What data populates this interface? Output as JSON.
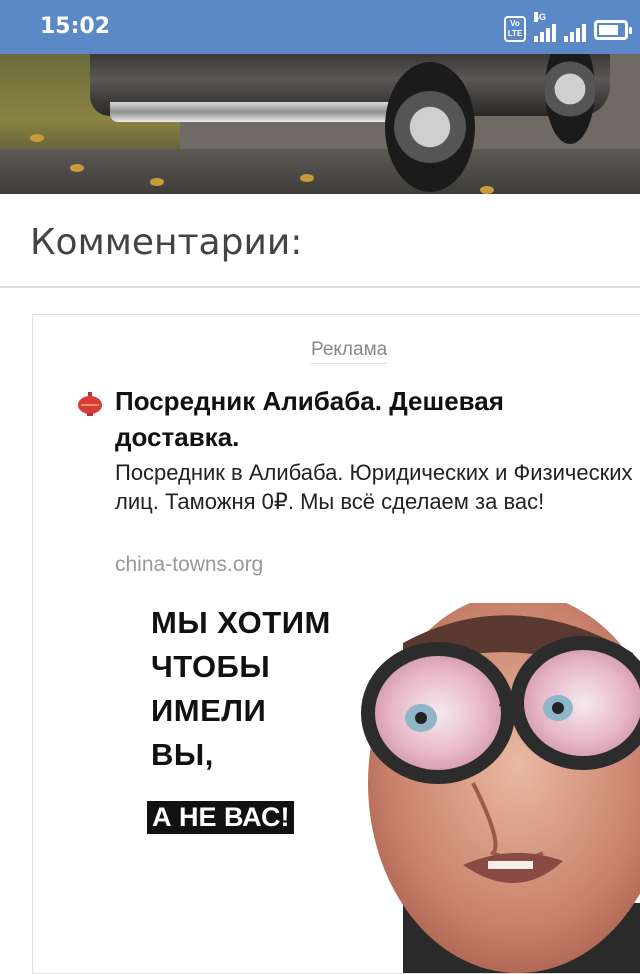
{
  "status_bar": {
    "time": "15:02",
    "volte_label": "Vo LTE",
    "network_label": "4G",
    "battery_level": 0.8,
    "color": "#5b88c6"
  },
  "comments": {
    "title": "Комментарии:"
  },
  "ad": {
    "label": "Реклама",
    "favicon": "red-lantern-icon",
    "title": "Посредник Алибаба. Дешевая доставка.",
    "description": "Посредник в Алибаба. Юридических и Физических лиц. Таможня 0₽. Мы всё сделаем за вас!",
    "domain": "china-towns.org",
    "image": {
      "lines": [
        "МЫ ХОТИМ",
        "ЧТОБЫ",
        "ИМЕЛИ",
        "ВЫ,"
      ],
      "accent": "А НЕ ВАС!"
    }
  }
}
